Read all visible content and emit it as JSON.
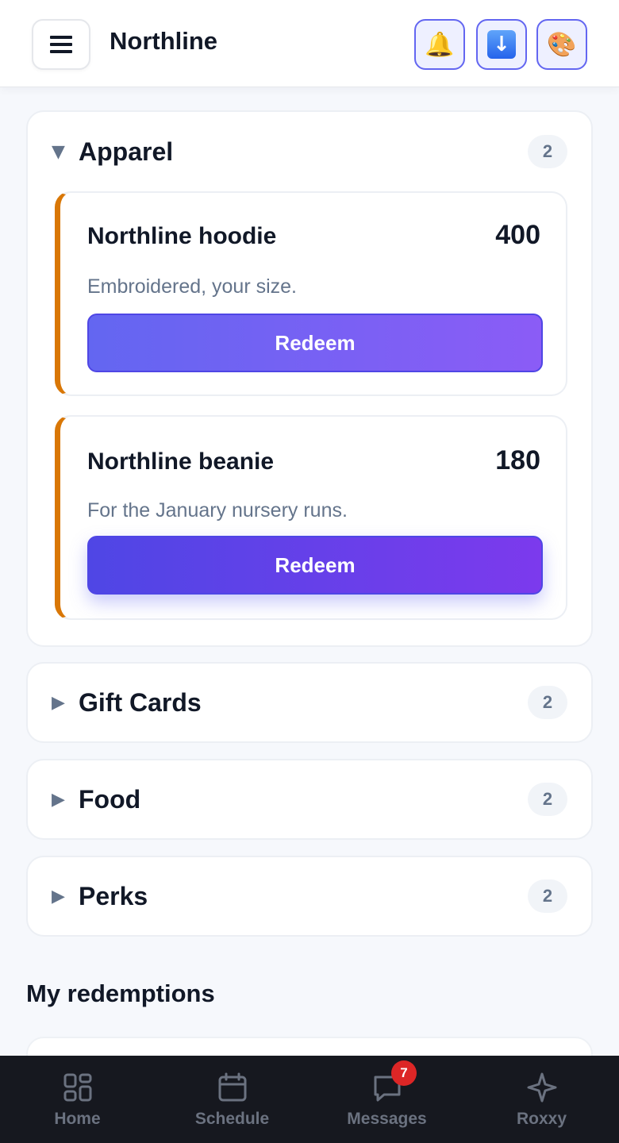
{
  "header": {
    "title": "Northline",
    "icons": [
      "menu-icon",
      "bell-icon",
      "download-icon",
      "palette-icon"
    ]
  },
  "categories": [
    {
      "title": "Apparel",
      "count": "2",
      "expanded": true,
      "items": [
        {
          "name": "Northline hoodie",
          "points": "400",
          "description": "Embroidered, your size.",
          "button": "Redeem"
        },
        {
          "name": "Northline beanie",
          "points": "180",
          "description": "For the January nursery runs.",
          "button": "Redeem"
        }
      ]
    },
    {
      "title": "Gift Cards",
      "count": "2",
      "expanded": false
    },
    {
      "title": "Food",
      "count": "2",
      "expanded": false
    },
    {
      "title": "Perks",
      "count": "2",
      "expanded": false
    }
  ],
  "redemptions": {
    "title": "My redemptions"
  },
  "nav": {
    "items": [
      {
        "label": "Home",
        "icon": "home-grid-icon"
      },
      {
        "label": "Schedule",
        "icon": "calendar-icon"
      },
      {
        "label": "Messages",
        "icon": "chat-icon",
        "badge": "7"
      },
      {
        "label": "Roxxy",
        "icon": "sparkle-icon"
      }
    ]
  },
  "colors": {
    "accent": "#6366f1",
    "card_stripe": "#d97706",
    "badge": "#dc2626",
    "nav_bg": "#16181f"
  }
}
